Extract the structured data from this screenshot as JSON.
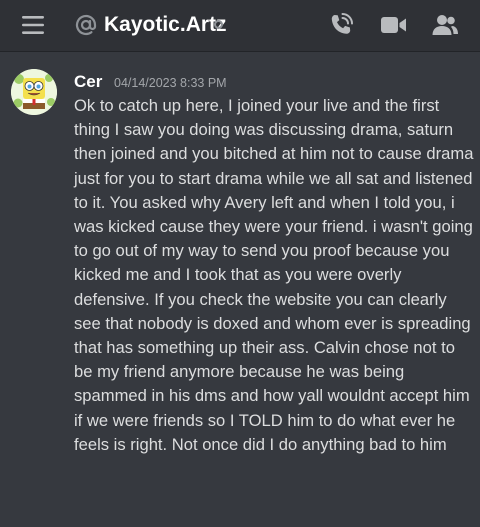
{
  "header": {
    "channel_name": "Kayotic.Artz",
    "icons": {
      "menu": "hamburger-menu-icon",
      "at": "at-sign-icon",
      "status": "offline-status-icon",
      "call": "phone-call-icon",
      "video": "video-camera-icon",
      "members": "members-icon"
    }
  },
  "message": {
    "author": "Cer",
    "timestamp": "04/14/2023 8:33 PM",
    "content": "Ok to catch up here, I joined your live and the first thing I saw you doing was discussing drama, saturn then joined and you bitched at him not to cause drama just for you to start drama while we all sat and listened to it. You asked why Avery left and when I told you, i was kicked cause they were your friend. i wasn't going to go out of my way to send you proof because you kicked me and I took that as you were overly defensive. If you check the website you can clearly see that nobody is doxed and whom ever is spreading that has something up their ass. Calvin chose not to be my friend anymore because he was being spammed in his dms and how yall wouldnt accept him if we were friends so I TOLD him to do what ever he feels is right. Not once did I do anything bad to him"
  },
  "colors": {
    "background": "#36393f",
    "header_background": "#2f3136",
    "text": "#dcddde",
    "timestamp": "#a3a6aa",
    "icon": "#b9bbbe"
  }
}
